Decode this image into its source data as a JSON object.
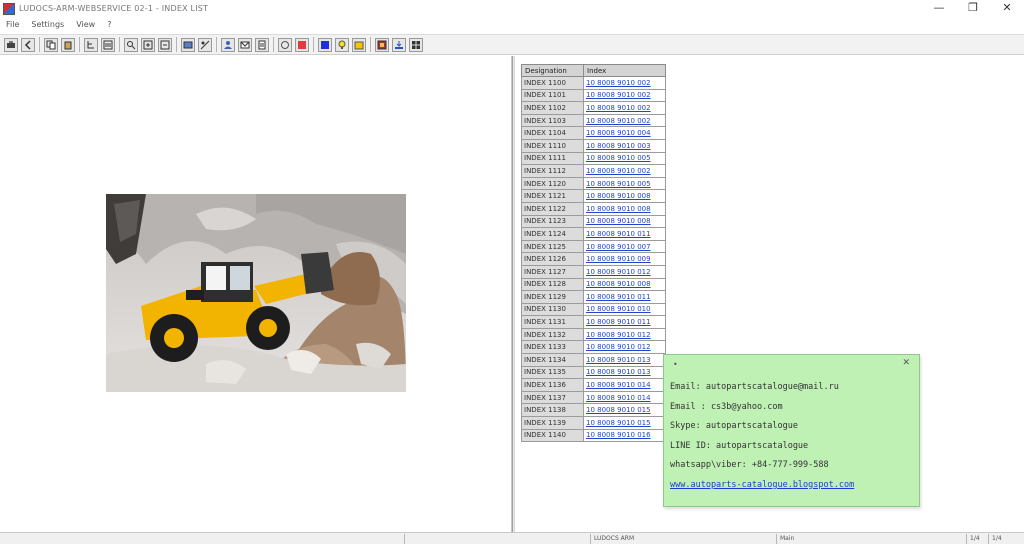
{
  "window": {
    "title": "LUDOCS-ARM-WEBSERVICE 02-1 - INDEX LIST",
    "minimize_glyph": "—",
    "maximize_glyph": "❐",
    "close_glyph": "✕"
  },
  "menu": {
    "items": [
      "File",
      "Settings",
      "View",
      "?"
    ]
  },
  "parts_table": {
    "headers": [
      "Designation",
      "Index"
    ],
    "rows": [
      {
        "designation": "INDEX 1100",
        "index": "10 8008 9010 002"
      },
      {
        "designation": "INDEX 1101",
        "index": "10 8008 9010 002"
      },
      {
        "designation": "INDEX 1102",
        "index": "10 8008 9010 002"
      },
      {
        "designation": "INDEX 1103",
        "index": "10 8008 9010 002"
      },
      {
        "designation": "INDEX 1104",
        "index": "10 8008 9010 004"
      },
      {
        "designation": "INDEX 1110",
        "index": "10 8008 9010 003"
      },
      {
        "designation": "INDEX 1111",
        "index": "10 8008 9010 005"
      },
      {
        "designation": "INDEX 1112",
        "index": "10 8008 9010 002"
      },
      {
        "designation": "INDEX 1120",
        "index": "10 8008 9010 005"
      },
      {
        "designation": "INDEX 1121",
        "index": "10 8008 9010 008"
      },
      {
        "designation": "INDEX 1122",
        "index": "10 8008 9010 008"
      },
      {
        "designation": "INDEX 1123",
        "index": "10 8008 9010 008"
      },
      {
        "designation": "INDEX 1124",
        "index": "10 8008 9010 011"
      },
      {
        "designation": "INDEX 1125",
        "index": "10 8008 9010 007"
      },
      {
        "designation": "INDEX 1126",
        "index": "10 8008 9010 009"
      },
      {
        "designation": "INDEX 1127",
        "index": "10 8008 9010 012"
      },
      {
        "designation": "INDEX 1128",
        "index": "10 8008 9010 008"
      },
      {
        "designation": "INDEX 1129",
        "index": "10 8008 9010 011"
      },
      {
        "designation": "INDEX 1130",
        "index": "10 8008 9010 010"
      },
      {
        "designation": "INDEX 1131",
        "index": "10 8008 9010 011"
      },
      {
        "designation": "INDEX 1132",
        "index": "10 8008 9010 012"
      },
      {
        "designation": "INDEX 1133",
        "index": "10 8008 9010 012"
      },
      {
        "designation": "INDEX 1134",
        "index": "10 8008 9010 013"
      },
      {
        "designation": "INDEX 1135",
        "index": "10 8008 9010 013"
      },
      {
        "designation": "INDEX 1136",
        "index": "10 8008 9010 014"
      },
      {
        "designation": "INDEX 1137",
        "index": "10 8008 9010 014"
      },
      {
        "designation": "INDEX 1138",
        "index": "10 8008 9010 015"
      },
      {
        "designation": "INDEX 1139",
        "index": "10 8008 9010 015"
      },
      {
        "designation": "INDEX 1140",
        "index": "10 8008 9010 016"
      }
    ]
  },
  "contact_popup": {
    "lines": [
      "Email: autopartscatalogue@mail.ru",
      "Email : cs3b@yahoo.com",
      "Skype: autopartscatalogue",
      "LINE ID: autopartscatalogue",
      "whatsapp\\viber: +84-777-999-588"
    ],
    "link": "www.autoparts-catalogue.blogspot.com",
    "close_glyph": "✕",
    "marker_glyph": "•"
  },
  "statusbar": {
    "cell_center": "LUDOCS ARM",
    "cell_right": "Main",
    "cell_page_a": "1/4",
    "cell_page_b": "1/4"
  },
  "colors": {
    "popup_bg": "#bff0b4",
    "link": "#2244cc",
    "loader_yellow": "#f2b400"
  },
  "icons": [
    "print-icon",
    "back-icon",
    "copy-icon",
    "paste-icon",
    "search-icon",
    "zoom-in-icon",
    "zoom-out-icon",
    "fit-icon",
    "tree-icon",
    "list-icon",
    "person-icon",
    "mail-icon",
    "find-icon",
    "info-icon",
    "stop-icon",
    "square-blue-icon",
    "lightbulb-icon",
    "star-icon",
    "book-icon",
    "download-icon",
    "exit-icon"
  ]
}
